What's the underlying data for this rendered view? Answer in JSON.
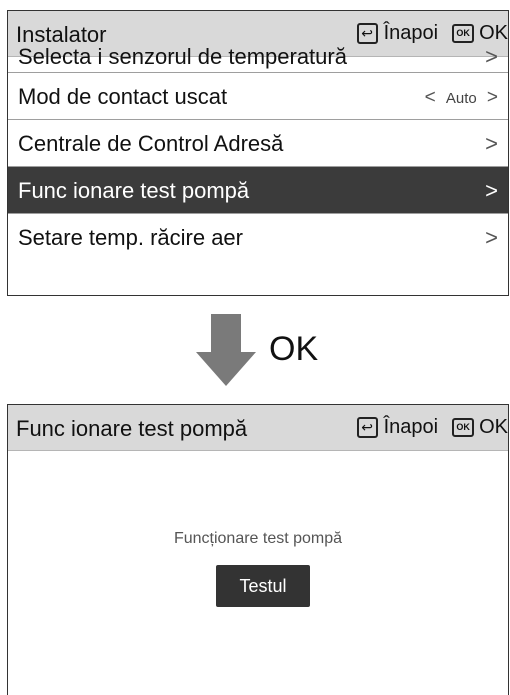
{
  "screen1": {
    "header": {
      "title": "Instalator",
      "back_label": "Înapoi",
      "ok_label": "OK",
      "ok_icon_text": "OK",
      "back_icon": "back-arrow-icon"
    },
    "items": [
      {
        "label": "Selecta i senzorul de temperatură",
        "chevron": ">"
      },
      {
        "label": "Mod de contact uscat",
        "value": "Auto",
        "left": "<",
        "right": ">"
      },
      {
        "label": "Centrale de Control Adresă",
        "chevron": ">"
      },
      {
        "label": "Func ionare test pompă",
        "chevron": ">"
      },
      {
        "label": "Setare temp. răcire aer",
        "chevron": ">"
      }
    ]
  },
  "transition": {
    "label": "OK"
  },
  "screen2": {
    "header": {
      "title": "Func ionare test pompă",
      "back_label": "Înapoi",
      "ok_label": "OK",
      "ok_icon_text": "OK"
    },
    "caption": "Funcționare test pompă",
    "button_label": "Testul"
  },
  "colors": {
    "header_bg": "#d9d9d9",
    "selected_bg": "#3b3b3b",
    "arrow": "#7a7a7a"
  }
}
